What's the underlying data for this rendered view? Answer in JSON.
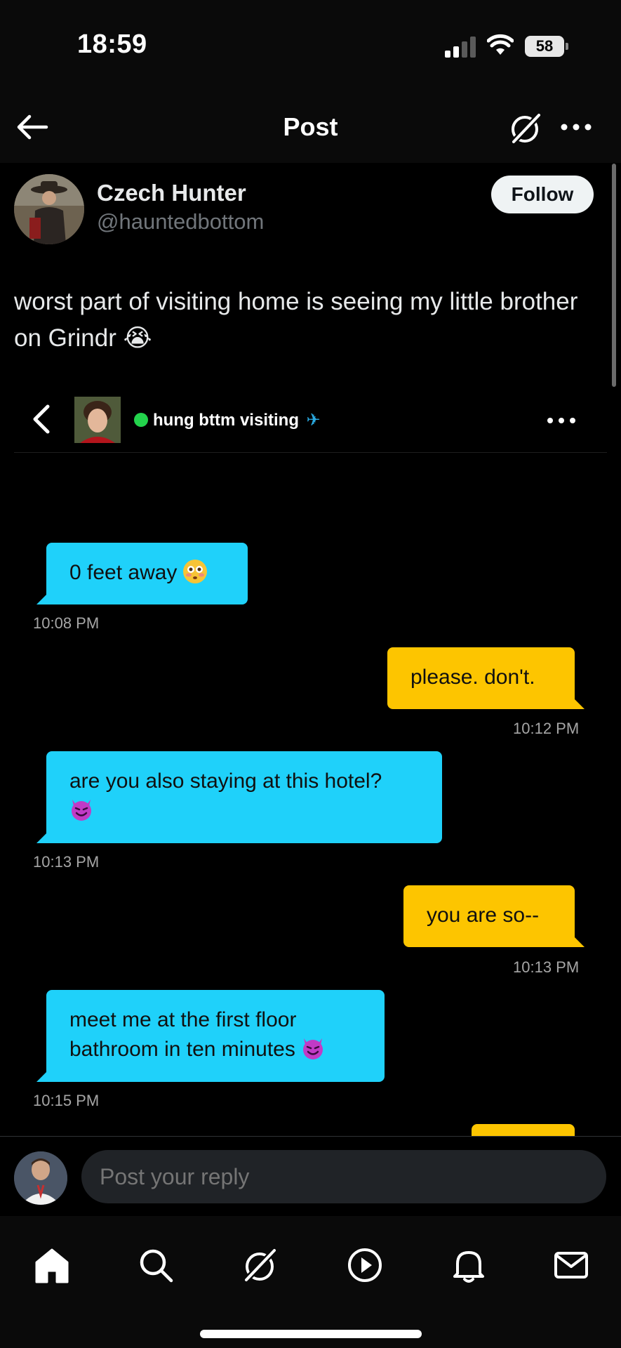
{
  "status_bar": {
    "time": "18:59",
    "battery_percent": "58"
  },
  "top_nav": {
    "title": "Post"
  },
  "post": {
    "author_name": "Czech Hunter",
    "author_handle": "@hauntedbottom",
    "follow_label": "Follow",
    "text": "worst part of visiting home is seeing my little brother on Grindr 😭"
  },
  "embedded_chat": {
    "contact_name": "hung bttm visiting",
    "messages": [
      {
        "direction": "in",
        "text": "0 feet away",
        "emoji": "flushed-face",
        "time": "10:08 PM"
      },
      {
        "direction": "out",
        "text": "please. don't.",
        "time": "10:12 PM"
      },
      {
        "direction": "in",
        "text": "are you also staying at this hotel?",
        "emoji": "smiling-devil",
        "time": "10:13 PM"
      },
      {
        "direction": "out",
        "text": "you are so--",
        "time": "10:13 PM"
      },
      {
        "direction": "in",
        "text": "meet me at the first floor bathroom in ten minutes",
        "emoji": "smiling-devil",
        "time": "10:15 PM"
      }
    ]
  },
  "reply": {
    "placeholder": "Post your reply"
  },
  "bottom_nav": {
    "tabs": [
      "home-icon",
      "search-icon",
      "grok-icon",
      "video-icon",
      "notifications-icon",
      "messages-icon"
    ]
  },
  "colors": {
    "incoming_bubble": "#1fd1fa",
    "outgoing_bubble": "#fdc500",
    "online": "#23d34c",
    "background": "#000000"
  }
}
